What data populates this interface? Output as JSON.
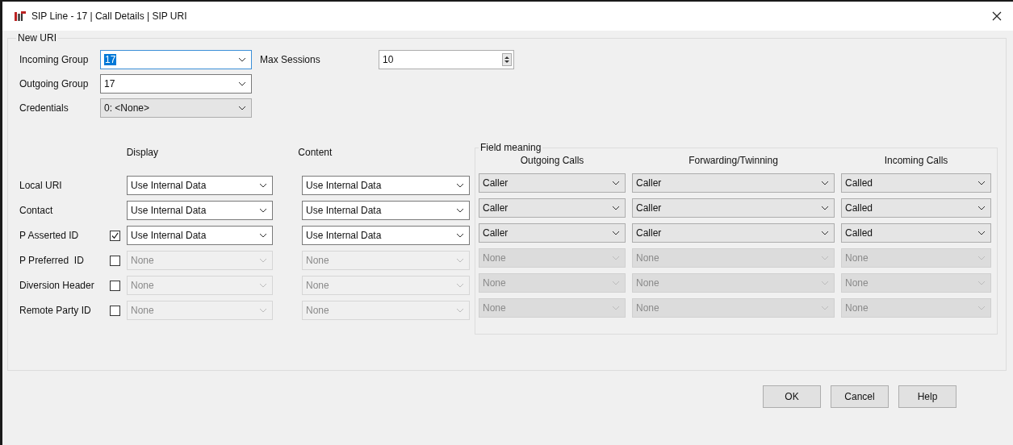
{
  "window": {
    "title": "SIP Line - 17 | Call Details | SIP URI"
  },
  "group": {
    "title": "New URI",
    "fields": [
      {
        "label": "Incoming Group",
        "value": "17",
        "kind": "editable",
        "highlighted": true
      },
      {
        "label": "Outgoing Group",
        "value": "17",
        "kind": "editable",
        "highlighted": false
      },
      {
        "label": "Credentials",
        "value": "0: <None>",
        "kind": "list",
        "highlighted": false
      }
    ],
    "max_sessions": {
      "label": "Max Sessions",
      "value": "10"
    },
    "columns": [
      "Display",
      "Content"
    ],
    "field_meaning": {
      "title": "Field meaning",
      "columns": [
        "Outgoing Calls",
        "Forwarding/Twinning",
        "Incoming Calls"
      ]
    },
    "rows": [
      {
        "label": "Local URI",
        "kind": "plain",
        "disabled": false,
        "display": "Use Internal Data",
        "content": "Use Internal Data",
        "outgoing": "Caller",
        "forwarding": "Caller",
        "incoming": "Called"
      },
      {
        "label": "Contact",
        "kind": "plain",
        "disabled": false,
        "display": "Use Internal Data",
        "content": "Use Internal Data",
        "outgoing": "Caller",
        "forwarding": "Caller",
        "incoming": "Called"
      },
      {
        "label": "P Asserted ID",
        "kind": "checkbox",
        "checked": true,
        "disabled": false,
        "display": "Use Internal Data",
        "content": "Use Internal Data",
        "outgoing": "Caller",
        "forwarding": "Caller",
        "incoming": "Called"
      },
      {
        "label": "P Preferred  ID",
        "kind": "checkbox",
        "checked": false,
        "disabled": true,
        "display": "None",
        "content": "None",
        "outgoing": "None",
        "forwarding": "None",
        "incoming": "None"
      },
      {
        "label": "Diversion Header",
        "kind": "checkbox",
        "checked": false,
        "disabled": true,
        "display": "None",
        "content": "None",
        "outgoing": "None",
        "forwarding": "None",
        "incoming": "None"
      },
      {
        "label": "Remote Party ID",
        "kind": "checkbox",
        "checked": false,
        "disabled": true,
        "display": "None",
        "content": "None",
        "outgoing": "None",
        "forwarding": "None",
        "incoming": "None"
      }
    ]
  },
  "buttons": [
    "OK",
    "Cancel",
    "Help"
  ]
}
